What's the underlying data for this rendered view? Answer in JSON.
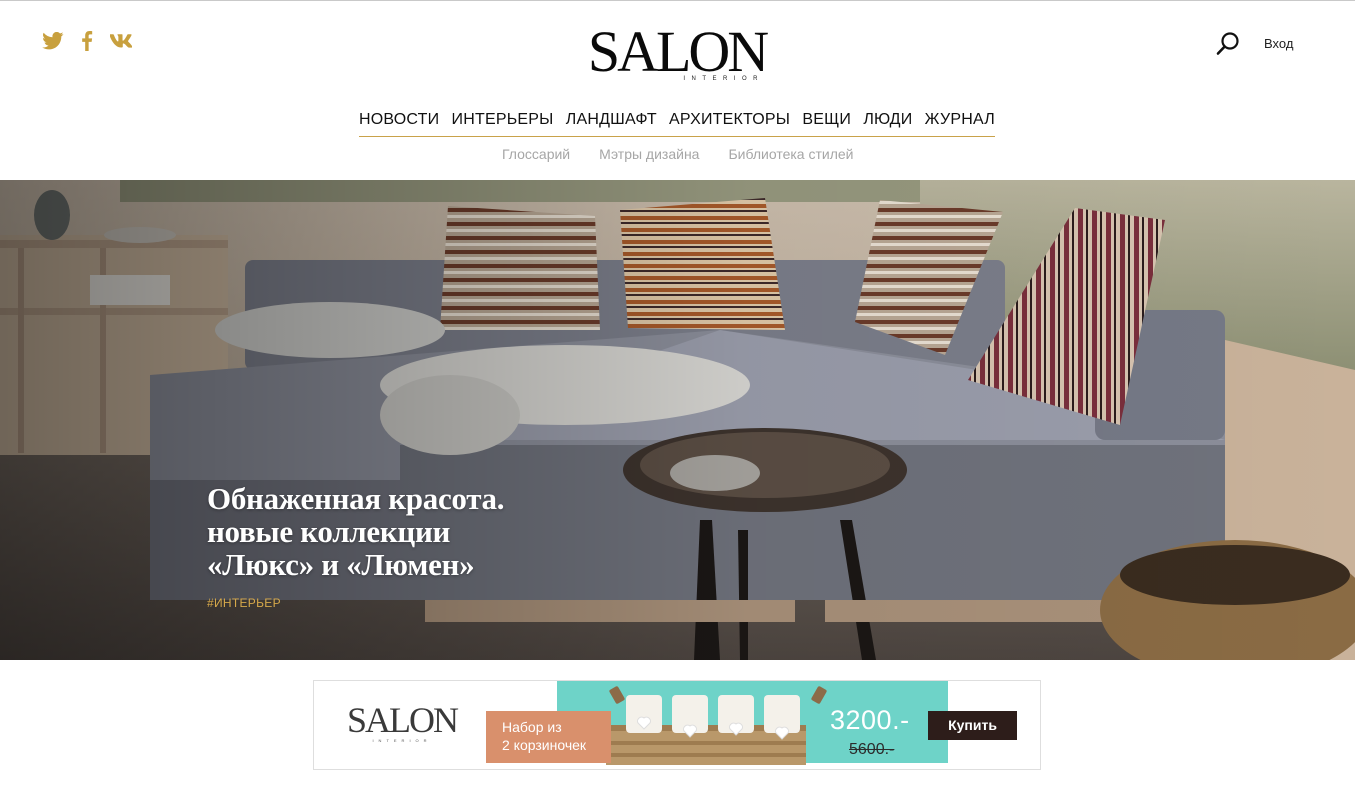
{
  "colors": {
    "accent_gold": "#c9a24a",
    "social_gold": "#c8a03e",
    "nav_text": "#111111",
    "subnav_text": "#a6a6a6",
    "banner_teal": "#6ed3c8",
    "banner_offer": "#d9906c",
    "buy_button": "#2d1d1a"
  },
  "header": {
    "social": [
      {
        "icon": "twitter-icon"
      },
      {
        "icon": "facebook-icon"
      },
      {
        "icon": "vk-icon"
      }
    ],
    "logo": {
      "word": "SALON",
      "sub": "INTERIOR"
    },
    "search_icon": "search-icon",
    "login_label": "Вход"
  },
  "nav": {
    "main": [
      "НОВОСТИ",
      "ИНТЕРЬЕРЫ",
      "ЛАНДШАФТ",
      "АРХИТЕКТОРЫ",
      "ВЕЩИ",
      "ЛЮДИ",
      "ЖУРНАЛ"
    ],
    "sub": [
      "Глоссарий",
      "Мэтры дизайна",
      "Библиотека стилей"
    ]
  },
  "hero": {
    "headline_lines": [
      "Обнаженная красота.",
      "новые коллекции",
      "«Люкс» и «Люмен»"
    ],
    "tag": "#ИНТЕРЬЕР"
  },
  "banner": {
    "logo_word": "SALON",
    "logo_sub": "INTERIOR",
    "offer_line1": "Набор из",
    "offer_line2": "2 корзиночек",
    "price": "3200.-",
    "old_price": "5600.-",
    "buy_label": "Купить"
  }
}
